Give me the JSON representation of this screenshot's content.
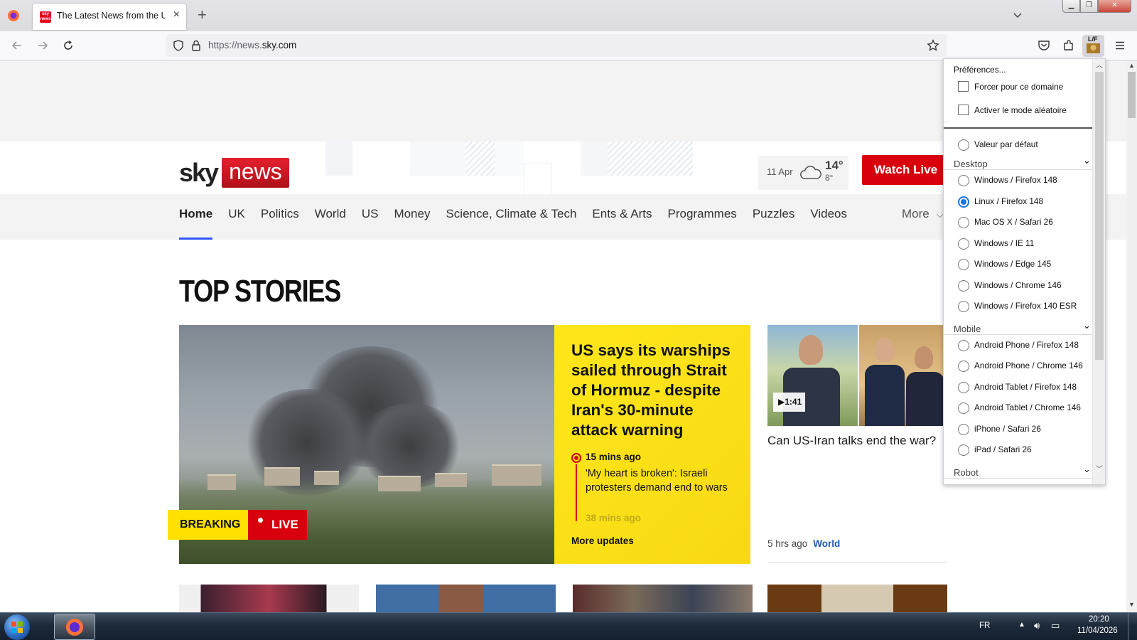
{
  "browser": {
    "tab_title": "The Latest News from the UK and Around the World | Sky News",
    "tab_favicon_text": "sky news",
    "url_prefix": "https://news.",
    "url_domain": "sky.com",
    "extension_badge": "L/F"
  },
  "site": {
    "logo_sky": "sky",
    "logo_news": "news",
    "weather": {
      "date": "11 Apr",
      "high": "14°",
      "low": "8°",
      "icon": "cloud-icon"
    },
    "watch_live": "Watch Live",
    "nav": [
      "Home",
      "UK",
      "Politics",
      "World",
      "US",
      "Money",
      "Science, Climate & Tech",
      "Ents & Arts",
      "Programmes",
      "Puzzles",
      "Videos"
    ],
    "nav_more": "More",
    "section_title": "TOP STORIES",
    "hero": {
      "breaking": "BREAKING",
      "live": "LIVE",
      "headline": "US says its warships sailed through Strait of Hormuz - despite Iran's 30-minute attack warning",
      "update_time": "15 mins ago",
      "update_text": "'My heart is broken': Israeli protesters demand end to wars",
      "update_time_2": "38 mins ago",
      "more_updates": "More updates"
    },
    "side_story": {
      "video_duration": "1:41",
      "headline": "Can US-Iran talks end the war?",
      "time": "5 hrs ago",
      "category": "World"
    }
  },
  "popup": {
    "preferences": "Préférences...",
    "force_domain": "Forcer pour ce domaine",
    "random_mode": "Activer le mode aléatoire",
    "default": "Valeur par défaut",
    "groups": [
      {
        "name": "Desktop",
        "items": [
          "Windows / Firefox 148",
          "Linux / Firefox 148",
          "Mac OS X / Safari 26",
          "Windows / IE 11",
          "Windows / Edge 145",
          "Windows / Chrome 146",
          "Windows / Firefox 140 ESR"
        ]
      },
      {
        "name": "Mobile",
        "items": [
          "Android Phone / Firefox 148",
          "Android Phone / Chrome 146",
          "Android Tablet / Firefox 148",
          "Android Tablet / Chrome 146",
          "iPhone / Safari 26",
          "iPad / Safari 26"
        ]
      },
      {
        "name": "Robot",
        "items": []
      }
    ],
    "selected": "Linux / Firefox 148"
  },
  "taskbar": {
    "lang": "FR",
    "time": "20:20",
    "date": "11/04/2026"
  },
  "colors": {
    "sky_red": "#d8000c",
    "breaking_yellow": "#ffe000",
    "nav_accent": "#3355ff",
    "radio_selected": "#1a73e8"
  }
}
